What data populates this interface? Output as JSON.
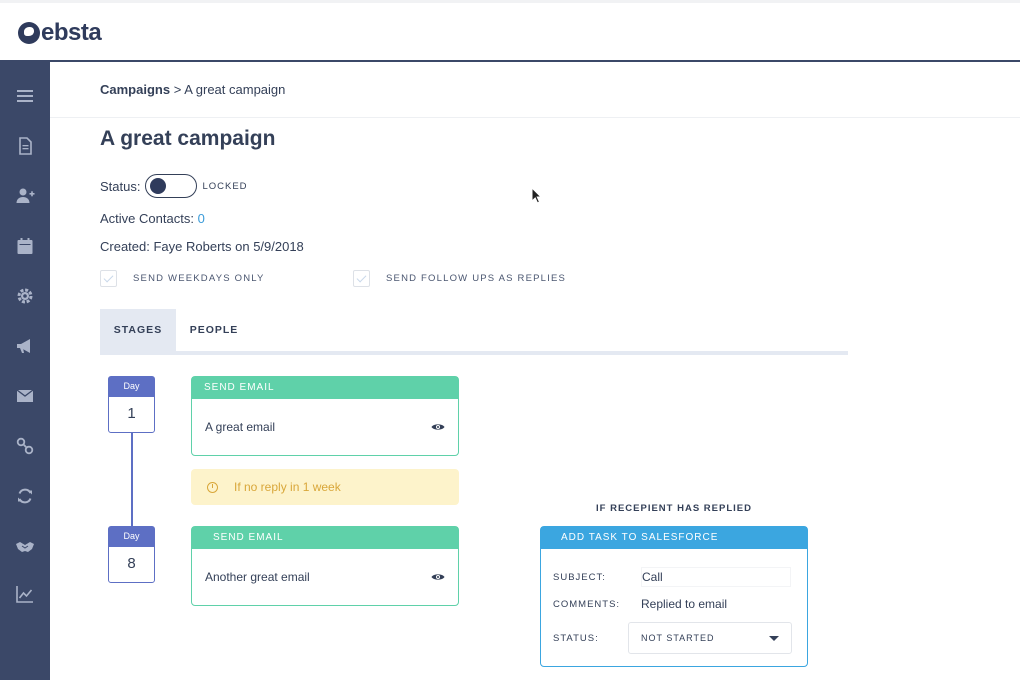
{
  "brand": {
    "name": "ebsta"
  },
  "sidebar": {
    "items": [
      {
        "icon": "menu-icon"
      },
      {
        "icon": "document-icon"
      },
      {
        "icon": "add-user-icon"
      },
      {
        "icon": "calendar-icon"
      },
      {
        "icon": "gear-icon"
      },
      {
        "icon": "megaphone-icon"
      },
      {
        "icon": "envelope-icon"
      },
      {
        "icon": "link-icon"
      },
      {
        "icon": "refresh-icon"
      },
      {
        "icon": "handshake-icon"
      },
      {
        "icon": "chart-icon"
      }
    ]
  },
  "breadcrumb": {
    "root": "Campaigns",
    "separator": ">",
    "current": "A great campaign"
  },
  "campaign": {
    "title": "A great campaign",
    "status_label": "Status:",
    "status_value": "LOCKED",
    "active_contacts_label": "Active Contacts:",
    "active_contacts_value": "0",
    "created_text": "Created: Faye Roberts on 5/9/2018",
    "options": {
      "weekdays": "SEND WEEKDAYS ONLY",
      "replies": "SEND FOLLOW UPS AS REPLIES"
    }
  },
  "tabs": [
    {
      "label": "STAGES",
      "active": true
    },
    {
      "label": "PEOPLE",
      "active": false
    }
  ],
  "stages": [
    {
      "day_label": "Day",
      "day": "1",
      "action": "SEND EMAIL",
      "email": "A great email"
    },
    {
      "day_label": "Day",
      "day": "8",
      "action": "SEND EMAIL",
      "email": "Another great email"
    }
  ],
  "wait": {
    "text": "If no reply in 1 week"
  },
  "branch": {
    "condition": "IF RECEPIENT HAS REPLIED",
    "action": "ADD TASK TO SALESFORCE",
    "subject_label": "SUBJECT:",
    "subject_value": "Call",
    "comments_label": "COMMENTS:",
    "comments_value": "Replied to email",
    "status_label": "STATUS:",
    "status_value": "NOT STARTED"
  },
  "colors": {
    "sidebar": "#3b4868",
    "email_accent": "#5fd1a9",
    "task_accent": "#3ba6e0",
    "day_accent": "#5d6fc4",
    "wait_bg": "#fdf3cb",
    "link": "#3b9bd9"
  }
}
